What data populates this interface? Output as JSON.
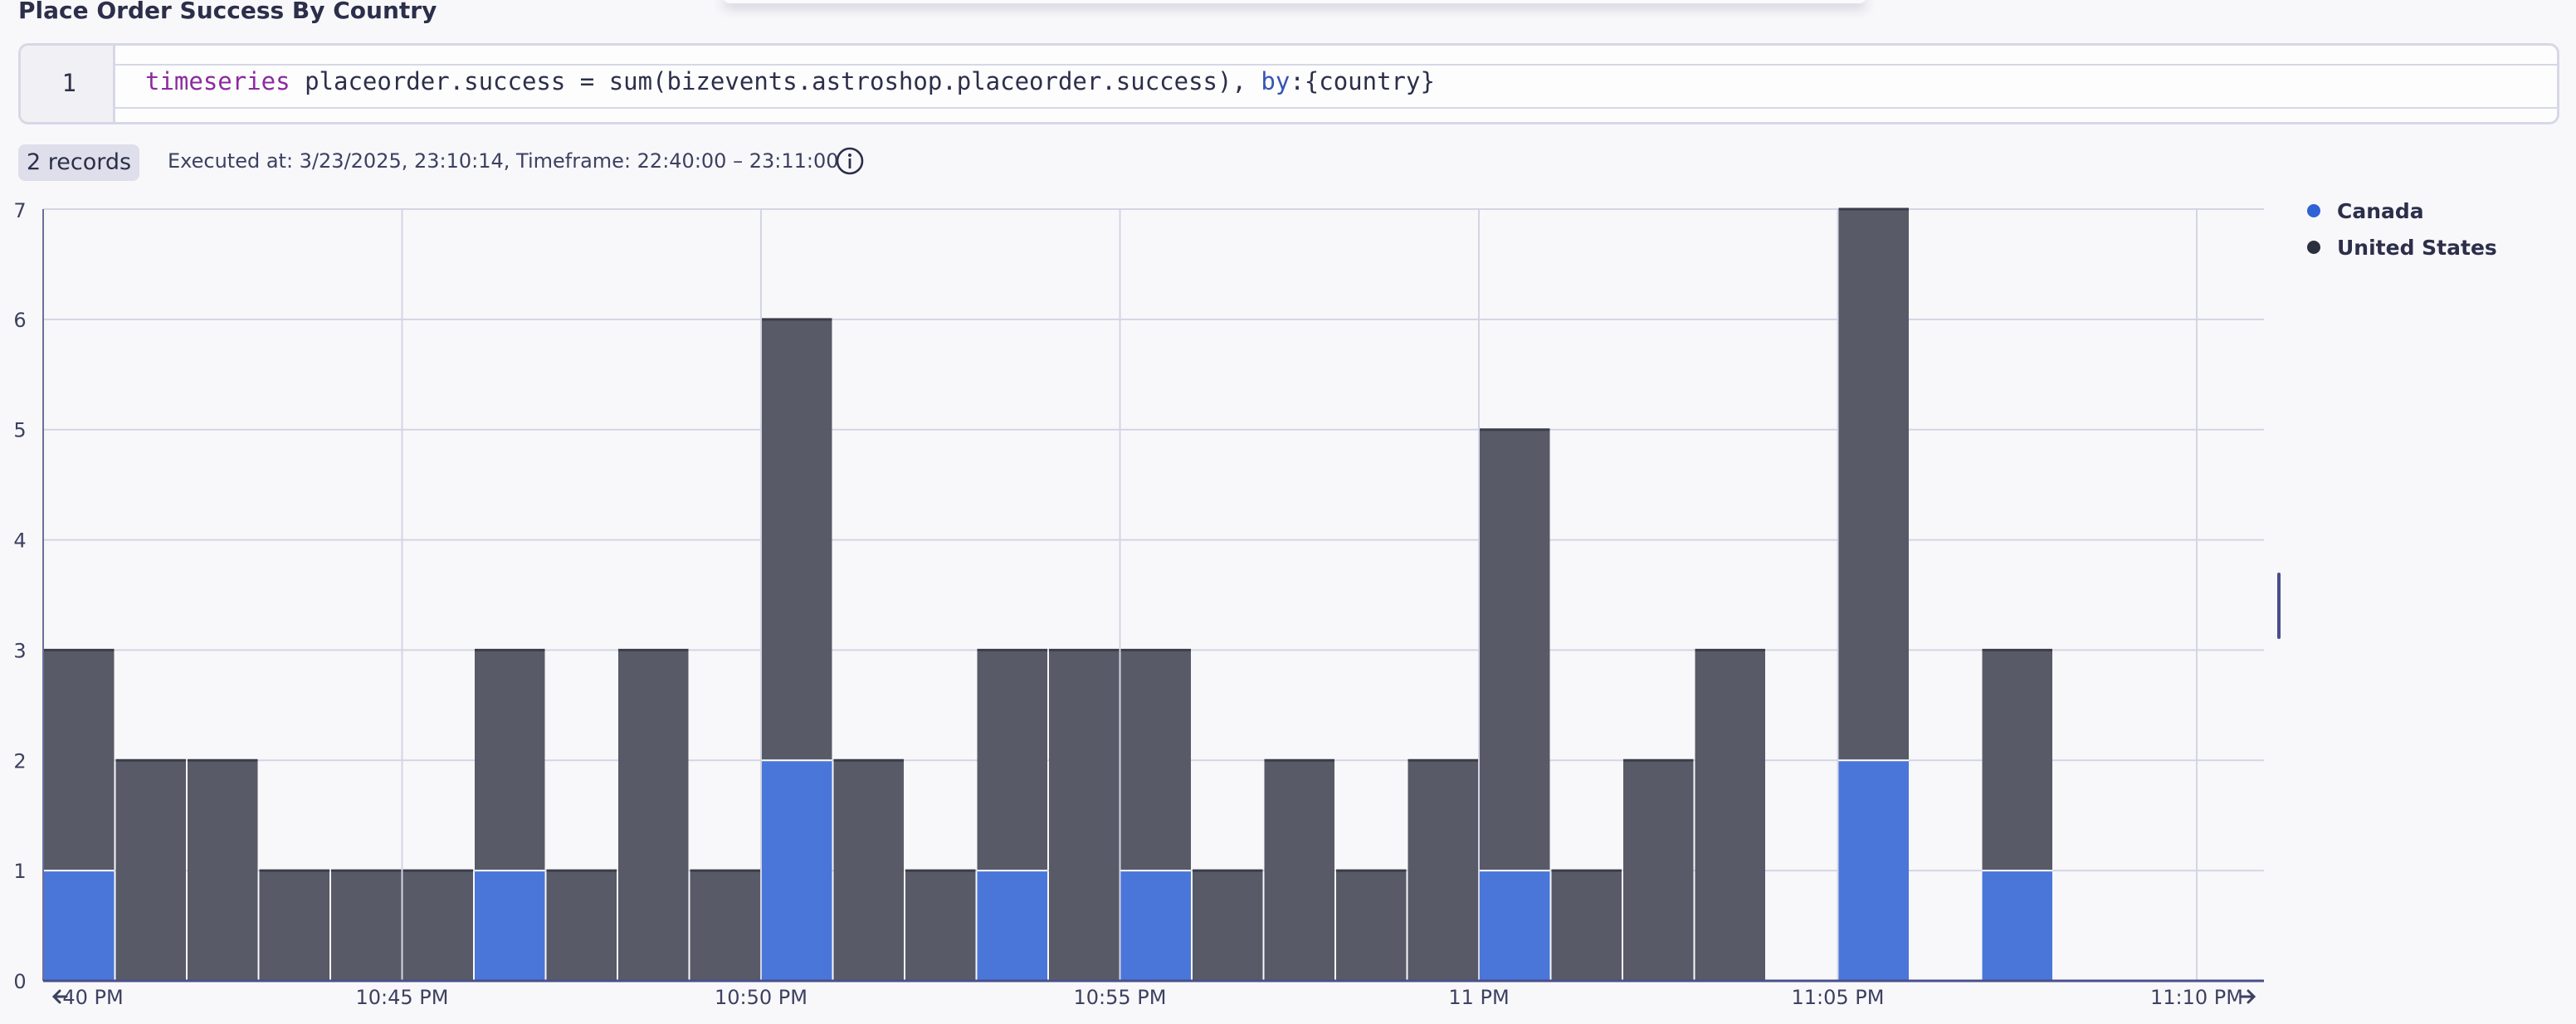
{
  "panel": {
    "title": "Place Order Success By Country"
  },
  "editor": {
    "line_number": "1",
    "code": {
      "kw": "timeseries",
      "mid": " placeorder.success = sum(bizevents.astroshop.placeorder.success), ",
      "by": "by",
      "tail": ":{country}"
    }
  },
  "result": {
    "records": "2 records",
    "executed": "Executed at: 3/23/2025, 23:10:14, Timeframe: 22:40:00 – 23:11:00",
    "info_icon": "info-icon"
  },
  "colors": {
    "canada": "#4a76d9",
    "united_states": "#555764",
    "canada_dot": "#2f62d5",
    "united_states_dot": "#2c2f3e"
  },
  "legend": [
    {
      "label": "Canada",
      "color": "#2f62d5"
    },
    {
      "label": "United States",
      "color": "#2c2f3e"
    }
  ],
  "nav": {
    "left_arrow": "arrow-left-icon",
    "right_arrow": "arrow-right-icon"
  },
  "chart_data": {
    "type": "bar",
    "stacked": true,
    "grid": true,
    "legend_position": "right",
    "ylim": [
      0,
      7
    ],
    "yticks": [
      0,
      1,
      2,
      3,
      4,
      5,
      6,
      7
    ],
    "xticks": [
      "40 PM",
      "10:45 PM",
      "10:50 PM",
      "10:55 PM",
      "11 PM",
      "11:05 PM",
      "11:10 PM"
    ],
    "categories": [
      "22:40",
      "22:41",
      "22:42",
      "22:43",
      "22:44",
      "22:45",
      "22:46",
      "22:47",
      "22:48",
      "22:49",
      "22:50",
      "22:51",
      "22:52",
      "22:53",
      "22:54",
      "22:55",
      "22:56",
      "22:57",
      "22:58",
      "22:59",
      "23:00",
      "23:01",
      "23:02",
      "23:03",
      "23:04",
      "23:05",
      "23:06",
      "23:07",
      "23:08",
      "23:09",
      "23:10"
    ],
    "series": [
      {
        "name": "Canada",
        "values": [
          1,
          0,
          0,
          0,
          0,
          0,
          1,
          0,
          0,
          0,
          2,
          0,
          0,
          1,
          0,
          1,
          0,
          0,
          0,
          0,
          1,
          0,
          0,
          0,
          0,
          2,
          0,
          1,
          0,
          0,
          0
        ]
      },
      {
        "name": "United States",
        "values": [
          2,
          2,
          2,
          1,
          1,
          1,
          2,
          1,
          3,
          1,
          4,
          2,
          1,
          2,
          3,
          2,
          1,
          2,
          1,
          2,
          4,
          1,
          2,
          3,
          0,
          5,
          0,
          2,
          0,
          0,
          0
        ]
      }
    ]
  }
}
